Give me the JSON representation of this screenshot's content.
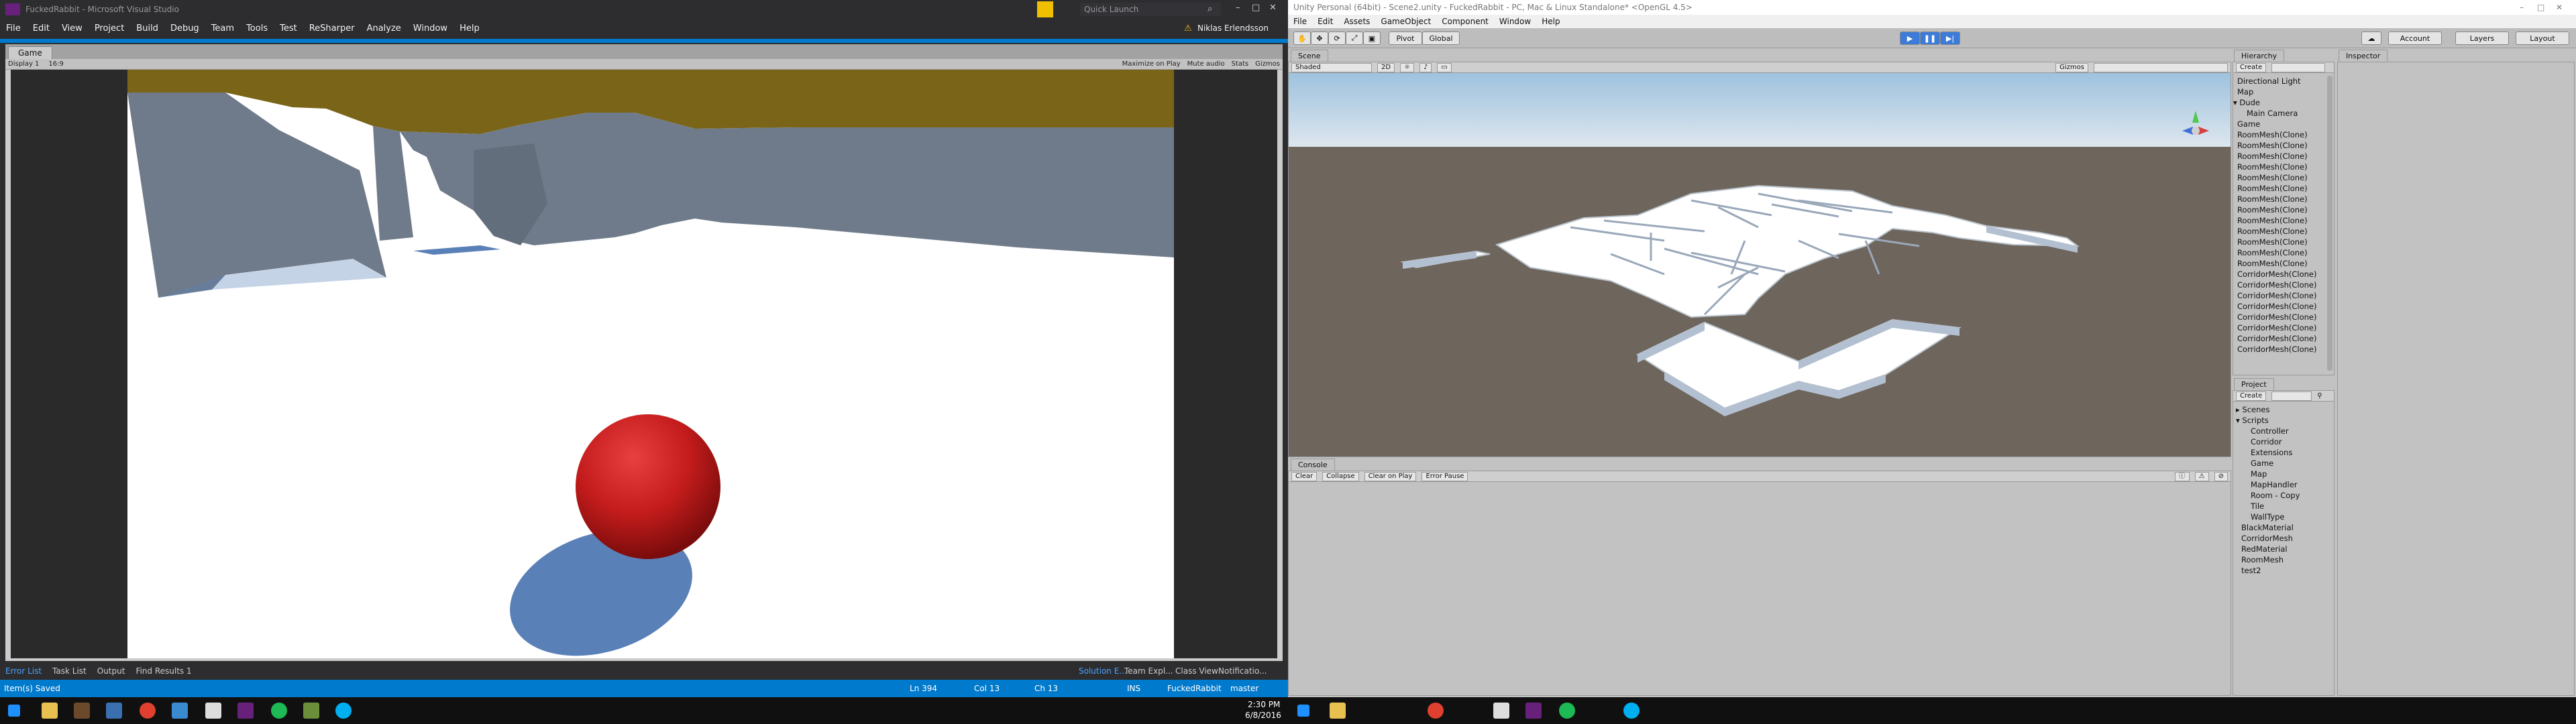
{
  "vs": {
    "title": "FuckedRabbit - Microsoft Visual Studio",
    "quick_launch": "Quick Launch",
    "user": "Niklas Erlendsson",
    "menu": [
      "File",
      "Edit",
      "View",
      "Project",
      "Build",
      "Debug",
      "Team",
      "Tools",
      "Test",
      "ReSharper",
      "Analyze",
      "Window",
      "Help"
    ],
    "game_tab": "Game",
    "display": "Display 1",
    "aspect": "16:9",
    "game_toolbar_right": [
      "Maximize on Play",
      "Mute audio",
      "Stats",
      "Gizmos"
    ],
    "bottom_tabs": [
      "Error List",
      "Task List",
      "Output",
      "Find Results 1"
    ],
    "bottom_right_tabs": [
      "Solution E...",
      "Team Expl...",
      "Class View",
      "Notificatio..."
    ],
    "status": {
      "left": "Item(s) Saved",
      "ln": "Ln 394",
      "col": "Col 13",
      "ch": "Ch 13",
      "ins": "INS",
      "project": "FuckedRabbit",
      "branch": "master"
    }
  },
  "unity": {
    "title": "Unity Personal (64bit) - Scene2.unity - FuckedRabbit - PC, Mac & Linux Standalone* <OpenGL 4.5>",
    "menu": [
      "File",
      "Edit",
      "Assets",
      "GameObject",
      "Component",
      "Window",
      "Help"
    ],
    "pivot": "Pivot",
    "global": "Global",
    "account": "Account",
    "layers": "Layers",
    "layout": "Layout",
    "scene_tab": "Scene",
    "shaded": "Shaded",
    "mode2d": "2D",
    "gizmos": "Gizmos",
    "persp": "",
    "hierarchy_tab": "Hierarchy",
    "create": "Create",
    "hierarchy_items": [
      "Directional Light",
      "Map",
      "▾ Dude",
      "Main Camera",
      "Game",
      "RoomMesh(Clone)",
      "RoomMesh(Clone)",
      "RoomMesh(Clone)",
      "RoomMesh(Clone)",
      "RoomMesh(Clone)",
      "RoomMesh(Clone)",
      "RoomMesh(Clone)",
      "RoomMesh(Clone)",
      "RoomMesh(Clone)",
      "RoomMesh(Clone)",
      "RoomMesh(Clone)",
      "RoomMesh(Clone)",
      "RoomMesh(Clone)",
      "CorridorMesh(Clone)",
      "CorridorMesh(Clone)",
      "CorridorMesh(Clone)",
      "CorridorMesh(Clone)",
      "CorridorMesh(Clone)",
      "CorridorMesh(Clone)",
      "CorridorMesh(Clone)",
      "CorridorMesh(Clone)"
    ],
    "inspector_tab": "Inspector",
    "project_tab": "Project",
    "project_items": [
      "▸ Scenes",
      "▾ Scripts",
      "Controller",
      "Corridor",
      "Extensions",
      "Game",
      "Map",
      "MapHandler",
      "Room - Copy",
      "Tile",
      "WallType",
      "BlackMaterial",
      "CorridorMesh",
      "RedMaterial",
      "RoomMesh",
      "test2"
    ],
    "console_tab": "Console",
    "console_buttons": [
      "Clear",
      "Collapse",
      "Clear on Play",
      "Error Pause"
    ]
  },
  "taskbar": {
    "time": "2:30 PM",
    "date": "6/8/2016"
  },
  "colors": {
    "vs_blue": "#007acc",
    "ceiling": "#7a6418",
    "walls": "#6f7b8a",
    "ball": "#cc2020",
    "shadow": "#5a80b8",
    "sky": "#c8dcec",
    "ground": "#6e655c"
  }
}
